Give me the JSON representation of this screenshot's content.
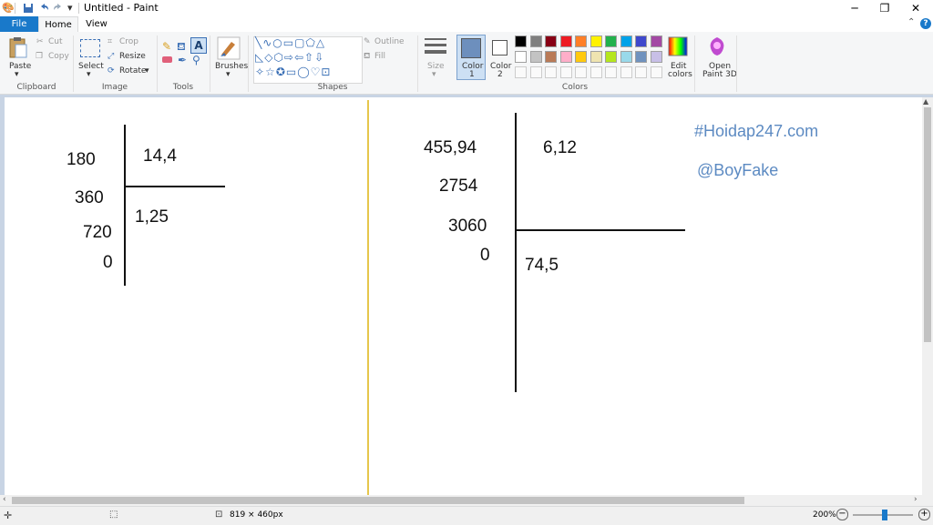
{
  "window": {
    "title": "Untitled - Paint",
    "controls": {
      "minimize": "─",
      "maximize": "❐",
      "close": "✕"
    }
  },
  "tabs": [
    {
      "label": "File"
    },
    {
      "label": "Home"
    },
    {
      "label": "View"
    }
  ],
  "help": {
    "collapse": "⌃",
    "help": "?"
  },
  "ribbon": {
    "clipboard": {
      "group": "Clipboard",
      "paste": "Paste",
      "cut": "Cut",
      "copy": "Copy"
    },
    "image": {
      "group": "Image",
      "select": "Select",
      "crop": "Crop",
      "resize": "Resize",
      "rotate": "Rotate"
    },
    "tools": {
      "group": "Tools"
    },
    "brushes": {
      "label": "Brushes"
    },
    "shapes": {
      "group": "Shapes",
      "outline": "Outline",
      "fill": "Fill"
    },
    "size": {
      "label": "Size"
    },
    "color1": {
      "label": "Color",
      "sub": "1",
      "value": "#6d8fbd"
    },
    "color2": {
      "label": "Color",
      "sub": "2",
      "value": "#ffffff"
    },
    "colors": {
      "group": "Colors",
      "palette_row1": [
        "#000000",
        "#7f7f7f",
        "#880015",
        "#ed1c24",
        "#ff7f27",
        "#fff200",
        "#22b14c",
        "#00a2e8",
        "#3f48cc",
        "#a349a4"
      ],
      "palette_row2": [
        "#ffffff",
        "#c3c3c3",
        "#b97a57",
        "#ffaec9",
        "#ffc90e",
        "#efe4b0",
        "#b5e61d",
        "#99d9ea",
        "#7092be",
        "#c8bfe7"
      ],
      "edit_colors": [
        "Edit",
        "colors"
      ]
    },
    "paint3d": {
      "line1": "Open",
      "line2": "Paint 3D"
    }
  },
  "canvas": {
    "left": {
      "dividend": "180",
      "divisor": "14,4",
      "remainder1": "360",
      "remainder2": "720",
      "remainder3": "0",
      "quotient": "1,25"
    },
    "right": {
      "dividend": "455,94",
      "divisor": "6,12",
      "remainder1": "2754",
      "remainder2": "3060",
      "remainder3": "0",
      "quotient": "74,5"
    },
    "watermark1": "#Hoidap247.com",
    "watermark2": "@BoyFake",
    "separator_color": "#e6c64c"
  },
  "status": {
    "dimensions": "819 × 460px",
    "zoom": "200%",
    "zoom_out": "−",
    "zoom_in": "+"
  }
}
